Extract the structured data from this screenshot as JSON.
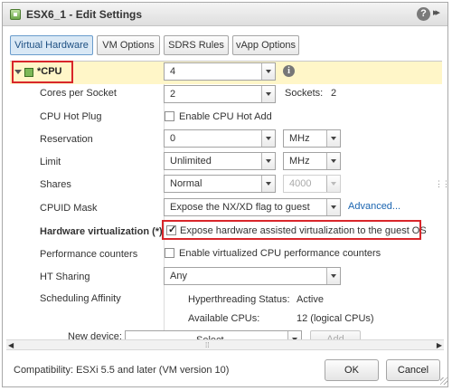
{
  "window": {
    "title": "ESX6_1 - Edit Settings",
    "help_label": "?",
    "expand_label": "▸▸"
  },
  "tabs": [
    {
      "label": "Virtual Hardware",
      "active": true
    },
    {
      "label": "VM Options",
      "active": false
    },
    {
      "label": "SDRS Rules",
      "active": false
    },
    {
      "label": "vApp Options",
      "active": false
    }
  ],
  "cpu": {
    "label": "*CPU",
    "count_value": "4",
    "info_label": "i",
    "cores_per_socket": {
      "label": "Cores per Socket",
      "value": "2",
      "sockets_label": "Sockets:",
      "sockets_value": "2"
    },
    "hot_plug": {
      "label": "CPU Hot Plug",
      "checkbox_label": "Enable CPU Hot Add",
      "checked": false
    },
    "reservation": {
      "label": "Reservation",
      "value": "0",
      "unit": "MHz"
    },
    "limit": {
      "label": "Limit",
      "value": "Unlimited",
      "unit": "MHz"
    },
    "shares": {
      "label": "Shares",
      "value": "Normal",
      "amount": "4000"
    },
    "cpuid_mask": {
      "label": "CPUID Mask",
      "value": "Expose the NX/XD flag to guest",
      "advanced_link": "Advanced..."
    },
    "hw_virtualization": {
      "label": "Hardware virtualization (*)",
      "checkbox_label": "Expose hardware assisted virtualization to the guest OS",
      "checked": true
    },
    "perf_counters": {
      "label": "Performance counters",
      "checkbox_label": "Enable virtualized CPU performance counters",
      "checked": false
    },
    "ht_sharing": {
      "label": "HT Sharing",
      "value": "Any"
    },
    "scheduling": {
      "label": "Scheduling Affinity",
      "hyperthreading_label": "Hyperthreading Status:",
      "hyperthreading_value": "Active",
      "available_label": "Available CPUs:",
      "available_value": "12 (logical CPUs)"
    }
  },
  "new_device": {
    "label": "New device:",
    "select_value": "Select",
    "add_label": "Add"
  },
  "footer": {
    "compatibility": "Compatibility: ESXi 5.5 and later (VM version 10)",
    "ok_label": "OK",
    "cancel_label": "Cancel"
  },
  "colors": {
    "highlight": "#d8262b",
    "active_tab": "#d9e8f5",
    "link": "#1a64b0"
  }
}
